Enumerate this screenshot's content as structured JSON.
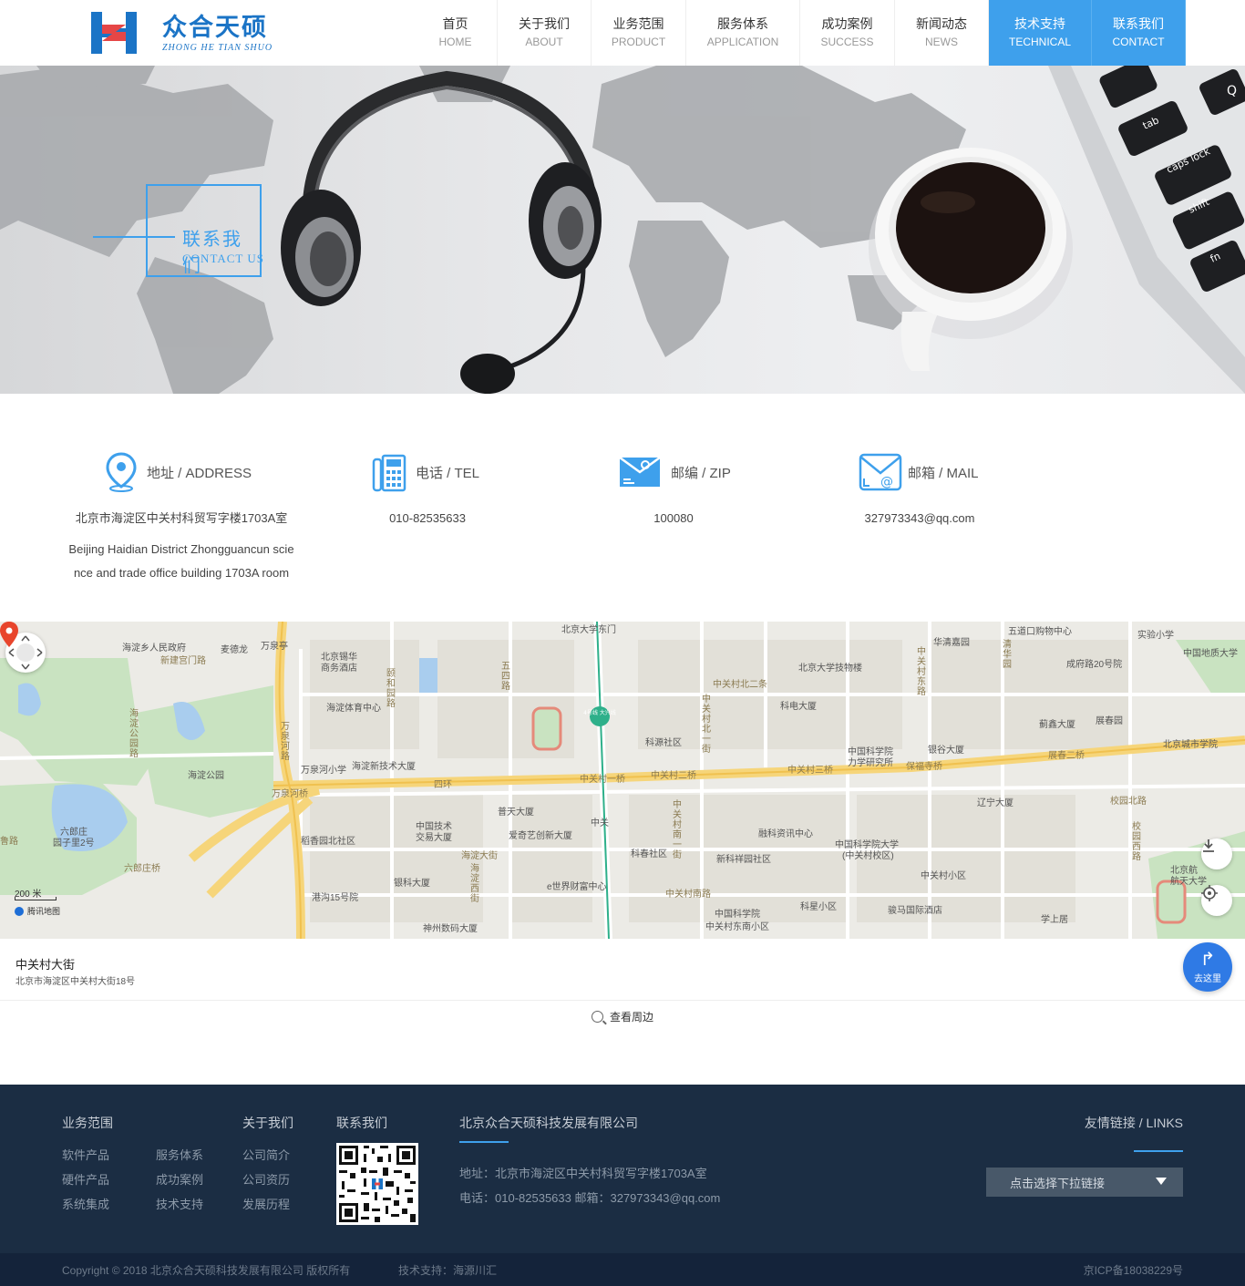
{
  "header": {
    "logo": {
      "cn": "众合天硕",
      "en": "ZHONG HE TIAN SHUO"
    },
    "nav": [
      {
        "cn": "首页",
        "en": "HOME"
      },
      {
        "cn": "关于我们",
        "en": "ABOUT"
      },
      {
        "cn": "业务范围",
        "en": "PRODUCT"
      },
      {
        "cn": "服务体系",
        "en": "APPLICATION"
      },
      {
        "cn": "成功案例",
        "en": "SUCCESS"
      },
      {
        "cn": "新闻动态",
        "en": "NEWS"
      },
      {
        "cn": "技术支持",
        "en": "TECHNICAL"
      },
      {
        "cn": "联系我们",
        "en": "CONTACT"
      }
    ],
    "accent_color": "#3ea0ec"
  },
  "banner": {
    "title_cn": "联系我们",
    "title_en": "CONTACT US",
    "keys": [
      "tab",
      "caps lock",
      "shift",
      "fn",
      "Q"
    ]
  },
  "contact": {
    "address": {
      "label": "地址 / ADDRESS",
      "cn": "北京市海淀区中关村科贸写字楼1703A室",
      "en1": "Beijing Haidian District Zhongguancun scie",
      "en2": "nce and trade office building 1703A room"
    },
    "tel": {
      "label": "电话 / TEL",
      "value": "010-82535633"
    },
    "zip": {
      "label": "邮编 / ZIP",
      "value": "100080"
    },
    "mail": {
      "label": "邮箱 / MAIL",
      "value": "327973343@qq.com"
    }
  },
  "map": {
    "labels": [
      {
        "t": "北京大学东门",
        "c": "poi"
      },
      {
        "t": "海淀乡人民政府",
        "c": "poi"
      },
      {
        "t": "麦德龙",
        "c": "poi"
      },
      {
        "t": "万泉亭",
        "c": "poi"
      },
      {
        "t": "新建宫门路",
        "c": "road"
      },
      {
        "t": "北京锡华",
        "c": "poi"
      },
      {
        "t": "商务酒店",
        "c": "poi"
      },
      {
        "t": "颐和园路",
        "c": "road"
      },
      {
        "t": "五四路",
        "c": "road"
      },
      {
        "t": "海淀体育中心",
        "c": "poi"
      },
      {
        "t": "中关村北二条",
        "c": "road"
      },
      {
        "t": "北京大学技物楼",
        "c": "poi"
      },
      {
        "t": "科电大厦",
        "c": "poi"
      },
      {
        "t": "华清嘉园",
        "c": "poi"
      },
      {
        "t": "五道口购物中心",
        "c": "poi"
      },
      {
        "t": "实验小学",
        "c": "poi"
      },
      {
        "t": "成府路20号院",
        "c": "poi"
      },
      {
        "t": "中国地质大学",
        "c": "poi"
      },
      {
        "t": "海淀公园",
        "c": "poi"
      },
      {
        "t": "万泉河小学",
        "c": "poi"
      },
      {
        "t": "海淀新技术大厦",
        "c": "poi"
      },
      {
        "t": "科源社区",
        "c": "poi"
      },
      {
        "t": "中国科学院",
        "c": "poi"
      },
      {
        "t": "力学研究所",
        "c": "poi"
      },
      {
        "t": "银谷大厦",
        "c": "poi"
      },
      {
        "t": "保福寺桥",
        "c": "road"
      },
      {
        "t": "蓟鑫大厦",
        "c": "poi"
      },
      {
        "t": "展春园",
        "c": "poi"
      },
      {
        "t": "展春二桥",
        "c": "road"
      },
      {
        "t": "北京城市学院",
        "c": "poi"
      },
      {
        "t": "四环",
        "c": "road"
      },
      {
        "t": "中关村一桥",
        "c": "road"
      },
      {
        "t": "中关村二桥",
        "c": "road"
      },
      {
        "t": "中关村三桥",
        "c": "road"
      },
      {
        "t": "万泉河桥",
        "c": "road"
      },
      {
        "t": "辽宁大厦",
        "c": "poi"
      },
      {
        "t": "校园北路",
        "c": "road"
      },
      {
        "t": "六郎庄",
        "c": "poi"
      },
      {
        "t": "园子里2号",
        "c": "poi"
      },
      {
        "t": "稻香园北社区",
        "c": "poi"
      },
      {
        "t": "中国技术",
        "c": "poi"
      },
      {
        "t": "交易大厦",
        "c": "poi"
      },
      {
        "t": "普天大厦",
        "c": "poi"
      },
      {
        "t": "爱奇艺创新大厦",
        "c": "poi"
      },
      {
        "t": "中关",
        "c": "poi"
      },
      {
        "t": "科春社区",
        "c": "poi"
      },
      {
        "t": "融科资讯中心",
        "c": "poi"
      },
      {
        "t": "新科祥园社区",
        "c": "poi"
      },
      {
        "t": "中国科学院大学",
        "c": "poi"
      },
      {
        "t": "(中关村校区)",
        "c": "poi"
      },
      {
        "t": "中关村小区",
        "c": "poi"
      },
      {
        "t": "北京航",
        "c": "poi"
      },
      {
        "t": "航天大学",
        "c": "poi"
      },
      {
        "t": "六郎庄桥",
        "c": "road"
      },
      {
        "t": "海淀大街",
        "c": "road"
      },
      {
        "t": "银科大厦",
        "c": "poi"
      },
      {
        "t": "e世界财富中心",
        "c": "poi"
      },
      {
        "t": "中关村南路",
        "c": "road"
      },
      {
        "t": "港沟15号院",
        "c": "poi"
      },
      {
        "t": "中国科学院",
        "c": "poi"
      },
      {
        "t": "中关村东南小区",
        "c": "poi"
      },
      {
        "t": "科星小区",
        "c": "poi"
      },
      {
        "t": "骏马国际酒店",
        "c": "poi"
      },
      {
        "t": "学上居",
        "c": "poi"
      },
      {
        "t": "神州数码大厦",
        "c": "poi"
      },
      {
        "t": "海淀公园路",
        "c": "road"
      },
      {
        "t": "万泉河路",
        "c": "road"
      },
      {
        "t": "中关村北一街",
        "c": "road"
      },
      {
        "t": "中关村南一街",
        "c": "road"
      },
      {
        "t": "中关村东路",
        "c": "road"
      },
      {
        "t": "海淀西街",
        "c": "road"
      },
      {
        "t": "清华园",
        "c": "road"
      },
      {
        "t": "校园西路",
        "c": "road"
      },
      {
        "t": "鲁路",
        "c": "road"
      }
    ],
    "scale": "200 米",
    "provider": "腾讯地图",
    "metro_label": "4号线 大兴线",
    "place_name": "中关村大街",
    "place_addr": "北京市海淀区中关村大街18号",
    "goto_label": "去这里",
    "nearby_label": "查看周边"
  },
  "footer": {
    "business": {
      "title": "业务范围",
      "items": [
        "软件产品",
        "服务体系",
        "硬件产品",
        "成功案例",
        "系统集成",
        "技术支持"
      ]
    },
    "about": {
      "title": "关于我们",
      "items": [
        "公司简介",
        "公司资历",
        "发展历程"
      ]
    },
    "contact_title": "联系我们",
    "company": {
      "name": "北京众合天硕科技发展有限公司",
      "address": "地址：北京市海淀区中关村科贸写字楼1703A室",
      "contact": "电话：010-82535633 邮箱：327973343@qq.com"
    },
    "links": {
      "title": "友情链接 / LINKS",
      "select": "点击选择下拉链接"
    },
    "copyright": "Copyright © 2018 北京众合天硕科技发展有限公司 版权所有",
    "tech": "技术支持：海源川汇",
    "icp": "京ICP备18038229号"
  }
}
